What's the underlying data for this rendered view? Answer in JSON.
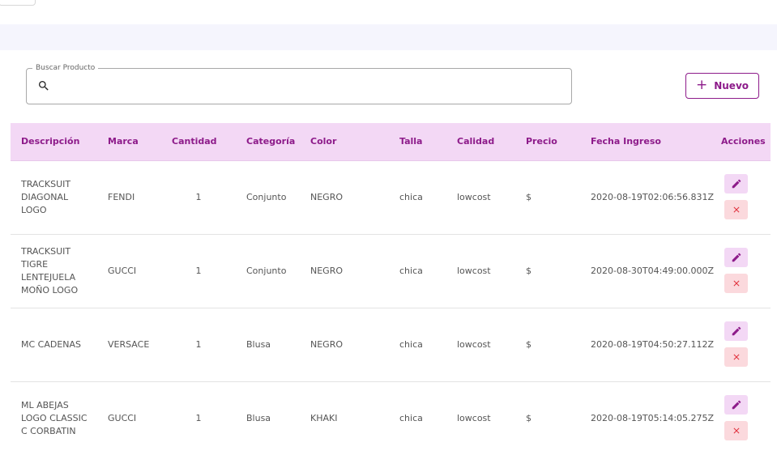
{
  "search": {
    "label": "Buscar Producto",
    "value": "",
    "placeholder": ""
  },
  "toolbar": {
    "new_label": "Nuevo"
  },
  "table": {
    "headers": {
      "descripcion": "Descripción",
      "marca": "Marca",
      "cantidad": "Cantidad",
      "categoria": "Categoría",
      "color": "Color",
      "talla": "Talla",
      "calidad": "Calidad",
      "precio": "Precio",
      "fecha": "Fecha Ingreso",
      "acciones": "Acciones"
    },
    "rows": [
      {
        "descripcion": "TRACKSUIT DIAGONAL LOGO",
        "marca": "FENDI",
        "cantidad": "1",
        "categoria": "Conjunto",
        "color": "NEGRO",
        "talla": "chica",
        "calidad": "lowcost",
        "precio": "$",
        "fecha": "2020-08-19T02:06:56.831Z"
      },
      {
        "descripcion": "TRACKSUIT TIGRE LENTEJUELA MOÑO LOGO",
        "marca": "GUCCI",
        "cantidad": "1",
        "categoria": "Conjunto",
        "color": "NEGRO",
        "talla": "chica",
        "calidad": "lowcost",
        "precio": "$",
        "fecha": "2020-08-30T04:49:00.000Z"
      },
      {
        "descripcion": "MC CADENAS",
        "marca": "VERSACE",
        "cantidad": "1",
        "categoria": "Blusa",
        "color": "NEGRO",
        "talla": "chica",
        "calidad": "lowcost",
        "precio": "$",
        "fecha": "2020-08-19T04:50:27.112Z"
      },
      {
        "descripcion": "ML ABEJAS LOGO CLASSIC C CORBATIN",
        "marca": "GUCCI",
        "cantidad": "1",
        "categoria": "Blusa",
        "color": "KHAKI",
        "talla": "chica",
        "calidad": "lowcost",
        "precio": "$",
        "fecha": "2020-08-19T05:14:05.275Z"
      }
    ]
  },
  "icons": {
    "search": "search-icon",
    "add": "plus-icon",
    "edit": "pencil-icon",
    "delete": "close-icon"
  },
  "colors": {
    "accent": "#8d1b8a",
    "header_bg": "#f3d8f5",
    "delete": "#e0303c",
    "delete_bg": "#fbd9dd",
    "band": "#f5f5fd"
  }
}
